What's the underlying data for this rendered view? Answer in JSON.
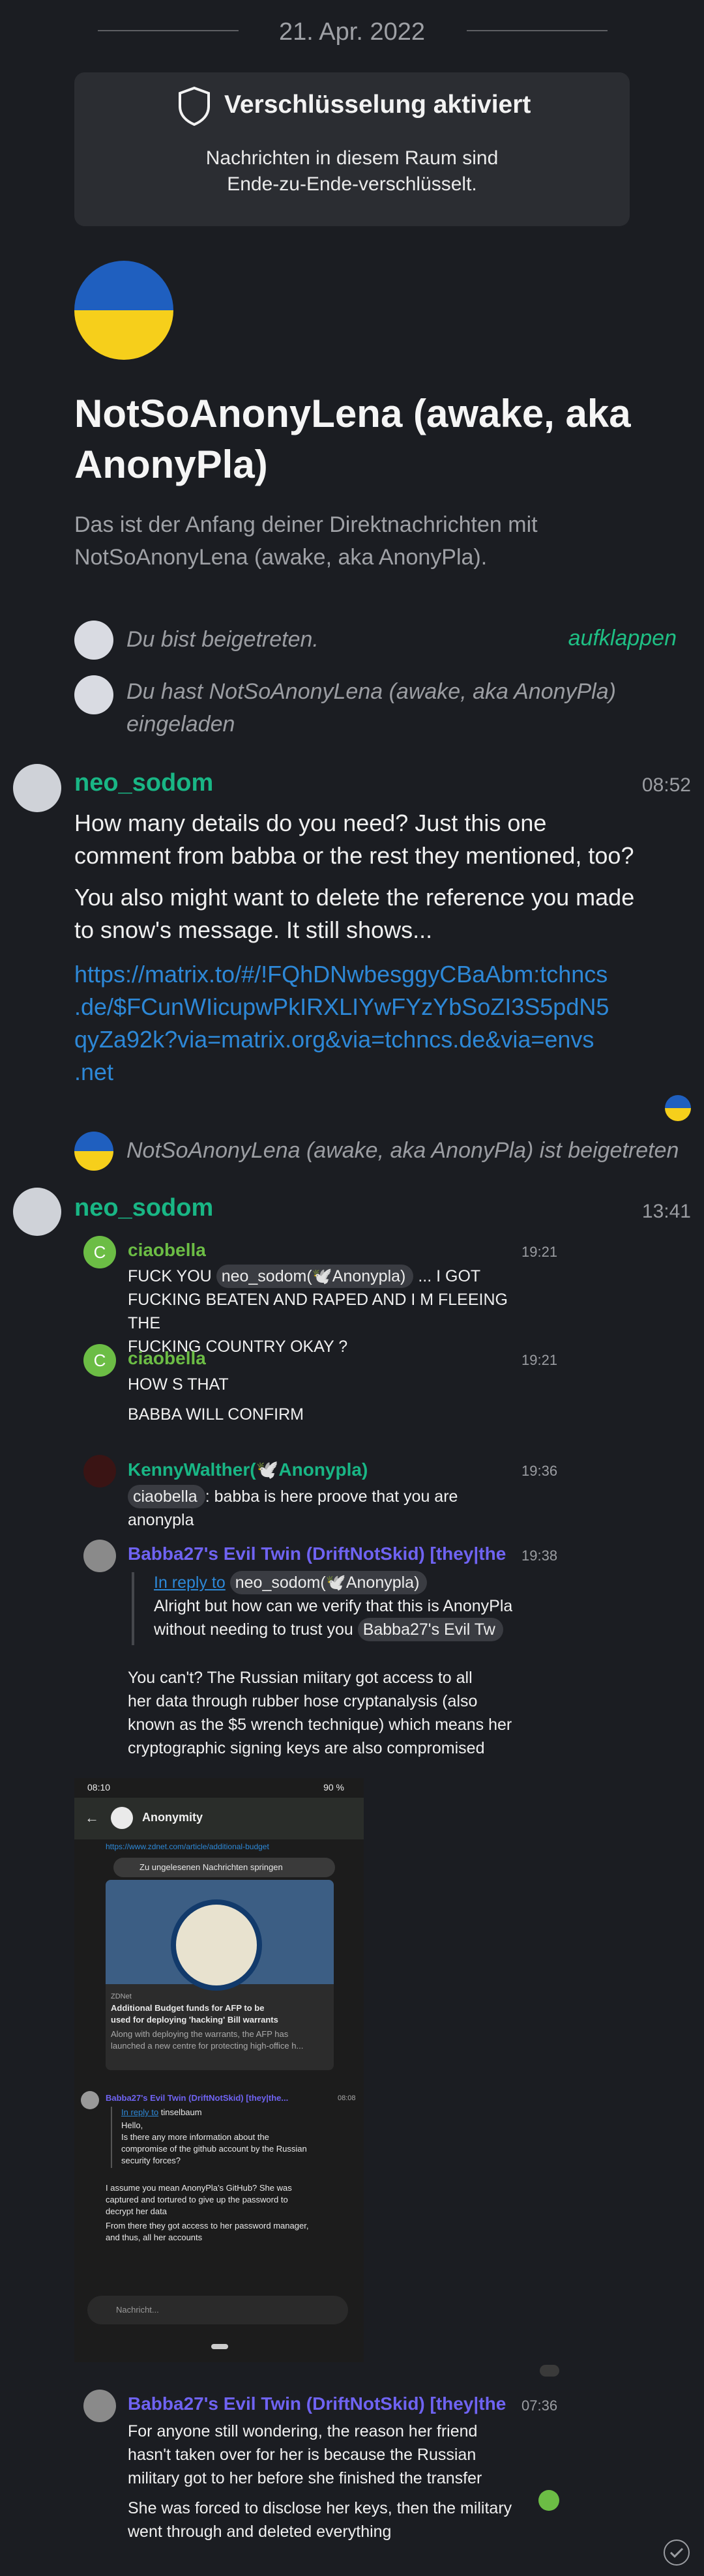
{
  "date_divider": "21. Apr. 2022",
  "encryption": {
    "title": "Verschlüsselung aktiviert",
    "line1": "Nachrichten in diesem Raum sind",
    "line2": "Ende-zu-Ende-verschlüsselt."
  },
  "room": {
    "name_line1": "NotSoAnonyLena (awake, aka",
    "name_line2": "AnonyPla)",
    "intro_line1": "Das ist der Anfang deiner Direktnachrichten mit",
    "intro_line2": "NotSoAnonyLena (awake, aka AnonyPla)."
  },
  "events": {
    "joined": "Du bist beigetreten.",
    "expand": "aufklappen",
    "invited_line1": "Du hast NotSoAnonyLena (awake, aka AnonyPla)",
    "invited_line2": "eingeladen",
    "other_joined": "NotSoAnonyLena (awake, aka AnonyPla) ist beigetreten"
  },
  "msg1": {
    "sender": "neo_sodom",
    "time": "08:52",
    "p1_l1": "How many details do you need? Just this one",
    "p1_l2": "comment from babba or the rest they mentioned, too?",
    "p2_l1": "You also might want to delete the reference you made",
    "p2_l2": "to snow's message. It still shows...",
    "link_l1": "https://matrix.to/#/!FQhDNwbesggyCBaAbm:tchncs",
    "link_l2": ".de/$FCunWIicupwPkIRXLIYwFYzYbSoZI3S5pdN5",
    "link_l3": "qyZa92k?via=matrix.org&via=tchncs.de&via=envs",
    "link_l4": ".net"
  },
  "msg2": {
    "sender": "neo_sodom",
    "time": "13:41",
    "q1": {
      "name": "ciaobella",
      "time": "19:21",
      "l1a": "FUCK YOU",
      "mention": "neo_sodom(🕊️Anonypla)",
      "l1b": "... I GOT",
      "l2": "FUCKING BEATEN AND RAPED AND I M FLEEING THE",
      "l3": "FUCKING COUNTRY OKAY ?"
    },
    "q2": {
      "name": "ciaobella",
      "time": "19:21",
      "l1": "HOW S THAT",
      "l2": "BABBA WILL CONFIRM"
    },
    "q3": {
      "name": "KennyWalther(🕊️Anonypla)",
      "time": "19:36",
      "mention": "ciaobella",
      "l1b": ": babba is here proove that you are",
      "l2": "anonypla"
    },
    "q4": {
      "name": "Babba27's Evil Twin (DriftNotSkid) [they|the...",
      "time": "19:38",
      "reply": "In reply to",
      "reply_mention": "neo_sodom(🕊️Anonypla)",
      "r1": "Alright but how can we verify that this is AnonyPla",
      "r2": "without needing to trust you",
      "r2_mention": "Babba27's Evil Tw",
      "b1": "You can't? The Russian miitary got access to all",
      "b2": "her data through rubber hose cryptanalysis (also",
      "b3": "known as the $5 wrench technique) which means her",
      "b4": "cryptographic signing keys are also compromised"
    },
    "shot": {
      "status_time": "08:10",
      "battery": "90 %",
      "room": "Anonymity",
      "url": "https://www.zdnet.com/article/additional-budget",
      "jump": "Zu ungelesenen Nachrichten springen",
      "source": "ZDNet",
      "headline1": "Additional Budget funds for AFP to be",
      "headline2": "used for deploying 'hacking' Bill warrants",
      "sub1": "Along with deploying the warrants, the AFP has",
      "sub2": "launched a new centre for protecting high-office h...",
      "sender": "Babba27's Evil Twin (DriftNotSkid) [they|the...",
      "sender_time": "08:08",
      "reply": "In reply to",
      "reply_user": "tinselbaum",
      "r1": "Hello,",
      "r2": "Is there any more information about the",
      "r3": "compromise of the github account by the Russian",
      "r4": "security forces?",
      "t1": "I assume you mean AnonyPla's GitHub? She was",
      "t2": "captured and tortured to give up the password to",
      "t3": "decrypt her data",
      "t4": "From there they got access to her password manager,",
      "t5": "and thus, all her accounts",
      "placeholder": "Nachricht..."
    },
    "q5": {
      "name": "Babba27's Evil Twin (DriftNotSkid) [they|the...",
      "time": "07:36",
      "l1": "For anyone still wondering, the reason her friend",
      "l2": "hasn't taken over for her is because the Russian",
      "l3": "military got to her before she finished the transfer",
      "l4": "She was forced to disclose her keys, then the military",
      "l5": "went through and deleted everything"
    }
  },
  "colors": {
    "accent": "#19b685",
    "link": "#2d88d7",
    "ciaobella": "#6cbd45",
    "babba": "#6f63f2",
    "background": "#1b1d22"
  }
}
